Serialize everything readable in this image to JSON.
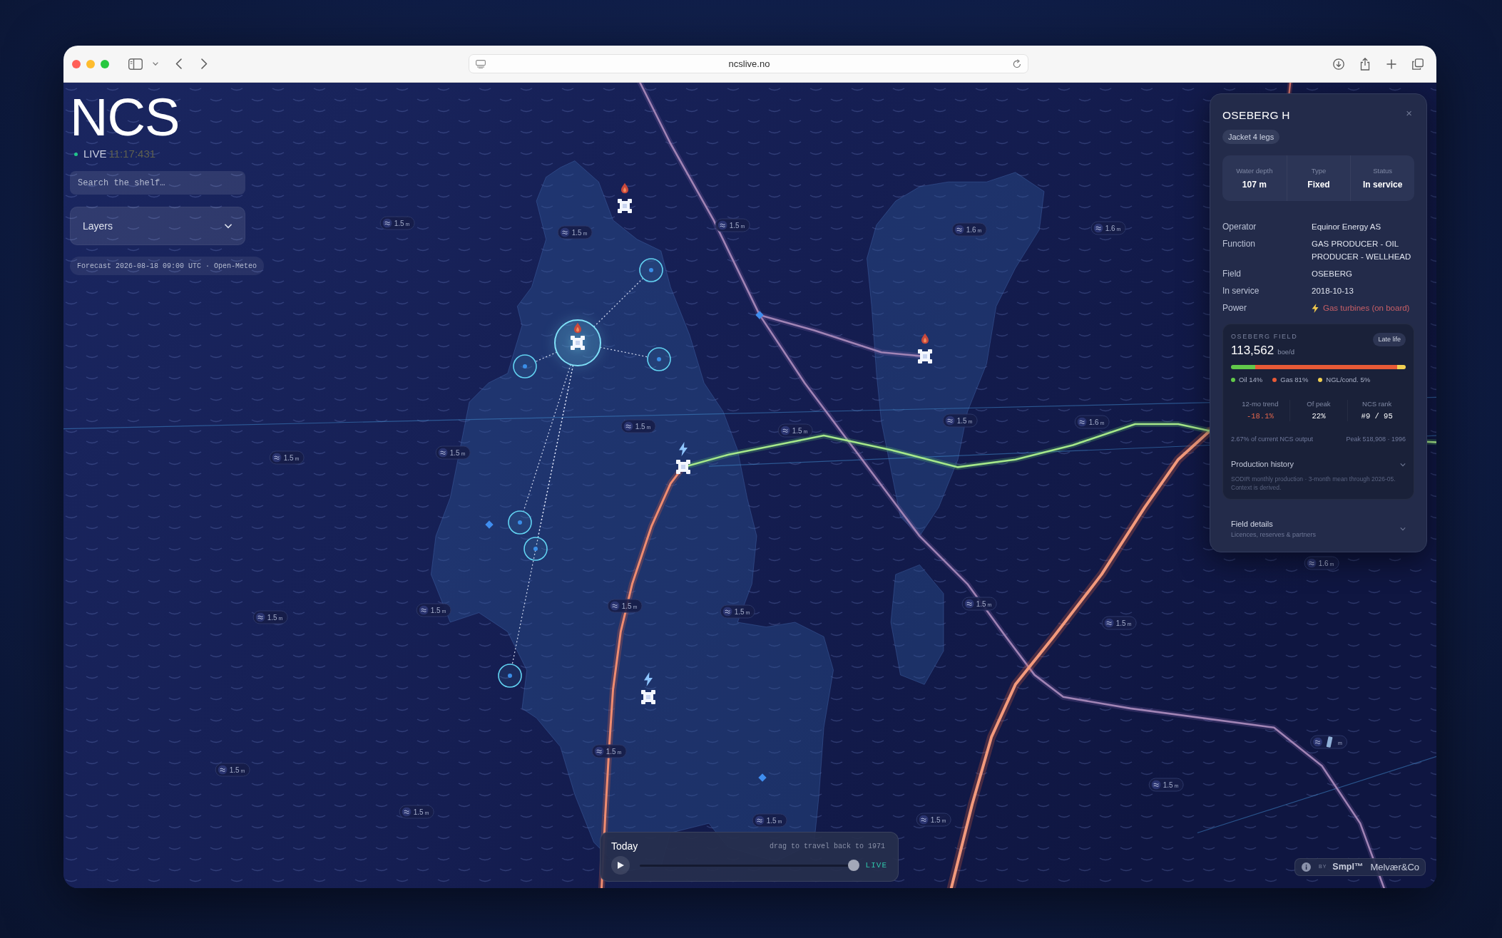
{
  "browser": {
    "url": "ncslive.no"
  },
  "header": {
    "title": "NCS",
    "live": true,
    "live_label": "LIVE",
    "time": "11:17:431"
  },
  "search": {
    "placeholder": "Search the shelf…"
  },
  "layers": {
    "label": "Layers",
    "expanded": false
  },
  "forecast": "Forecast 2026-08-18 09:00 UTC · Open-Meteo",
  "map": {
    "platforms": [
      {
        "kind": "flare",
        "selected": false
      },
      {
        "kind": "flare",
        "selected": true
      },
      {
        "kind": "flare",
        "selected": false
      },
      {
        "kind": "power",
        "selected": false
      },
      {
        "kind": "power",
        "selected": false
      }
    ],
    "wave_labels": [
      {
        "kind": "wave",
        "value": "1.5",
        "unit": "m"
      },
      {
        "kind": "wave",
        "value": "1.5",
        "unit": "m"
      },
      {
        "kind": "wave",
        "value": "1.5",
        "unit": "m"
      },
      {
        "kind": "wave",
        "value": "1.6",
        "unit": "m"
      },
      {
        "kind": "wave",
        "value": "1.6",
        "unit": "m"
      },
      {
        "kind": "wave",
        "value": "1.5",
        "unit": "m"
      },
      {
        "kind": "wave",
        "value": "1.5",
        "unit": "m"
      },
      {
        "kind": "wave",
        "value": "1.5",
        "unit": "m"
      },
      {
        "kind": "wave",
        "value": "1.6",
        "unit": "m"
      },
      {
        "kind": "wave",
        "value": "1.5",
        "unit": "m"
      },
      {
        "kind": "wave",
        "value": "1.5",
        "unit": "m"
      },
      {
        "kind": "wave",
        "value": "1.6",
        "unit": "m"
      },
      {
        "kind": "wave",
        "value": "1.5",
        "unit": "m"
      },
      {
        "kind": "wave",
        "value": "1.5",
        "unit": "m"
      },
      {
        "kind": "wave",
        "value": "1.5",
        "unit": "m"
      },
      {
        "kind": "wave",
        "value": "1.5",
        "unit": "m"
      },
      {
        "kind": "wave",
        "value": "1.5",
        "unit": "m"
      },
      {
        "kind": "wave",
        "value": "1.5",
        "unit": "m"
      },
      {
        "kind": "wave",
        "value": "1.5",
        "unit": "m"
      },
      {
        "kind": "covered",
        "unit": "m"
      },
      {
        "kind": "wave",
        "value": "1.5",
        "unit": "m"
      },
      {
        "kind": "wave",
        "value": "1.5",
        "unit": "m"
      },
      {
        "kind": "wave",
        "value": "1.5",
        "unit": "m"
      },
      {
        "kind": "wave",
        "value": "1.5",
        "unit": "m"
      },
      {
        "kind": "wave",
        "value": "1.5",
        "unit": "m"
      }
    ]
  },
  "panel": {
    "title": "OSEBERG H",
    "close": "×",
    "badge": "Jacket 4 legs",
    "stats": [
      {
        "label": "Water depth",
        "value": "107 m"
      },
      {
        "label": "Type",
        "value": "Fixed"
      },
      {
        "label": "Status",
        "value": "In service"
      }
    ],
    "properties": [
      {
        "kind": "text",
        "label": "Operator",
        "value": "Equinor Energy AS"
      },
      {
        "kind": "text",
        "label": "Function",
        "value": "GAS PRODUCER - OIL PRODUCER - WELLHEAD"
      },
      {
        "kind": "text",
        "label": "Field",
        "value": "OSEBERG"
      },
      {
        "kind": "text",
        "label": "In service",
        "value": "2018-10-13"
      },
      {
        "kind": "power",
        "label": "Power",
        "value": "Gas turbines (on board)"
      }
    ],
    "field": {
      "name": "OSEBERG FIELD",
      "phase": "Late life",
      "production": "113,562",
      "unit": "boe/d",
      "mix": [
        {
          "label": "Oil 14%",
          "level": 0.14,
          "color": "#62c94a"
        },
        {
          "label": "Gas 81%",
          "color": "#e85a36"
        },
        {
          "label": "NGL/cond. 5%",
          "level": 0.05,
          "color": "#f1cf52"
        }
      ],
      "metrics": [
        {
          "label": "12-mo trend",
          "value": "-18.1%",
          "negative": true
        },
        {
          "label": "Of peak",
          "value": "22%",
          "negative": false
        },
        {
          "label": "NCS rank",
          "value": "#9 / 95",
          "negative": false
        }
      ],
      "share_note": "2.67% of current NCS output",
      "peak_note": "Peak 518,908 · 1996",
      "history": {
        "title": "Production history",
        "expanded": false,
        "note": "SODIR monthly production · 3-month mean through 2026-05. Context is derived."
      }
    },
    "details": {
      "title": "Field details",
      "subtitle": "Licences, reserves & partners",
      "expanded": false
    }
  },
  "timeline": {
    "title": "Today",
    "hint": "drag to travel back to 1971",
    "playing": false,
    "level": 1,
    "live_label": "LIVE"
  },
  "credit": {
    "by": "BY",
    "brands": [
      "Smpl™",
      "Melvær&Co"
    ]
  }
}
